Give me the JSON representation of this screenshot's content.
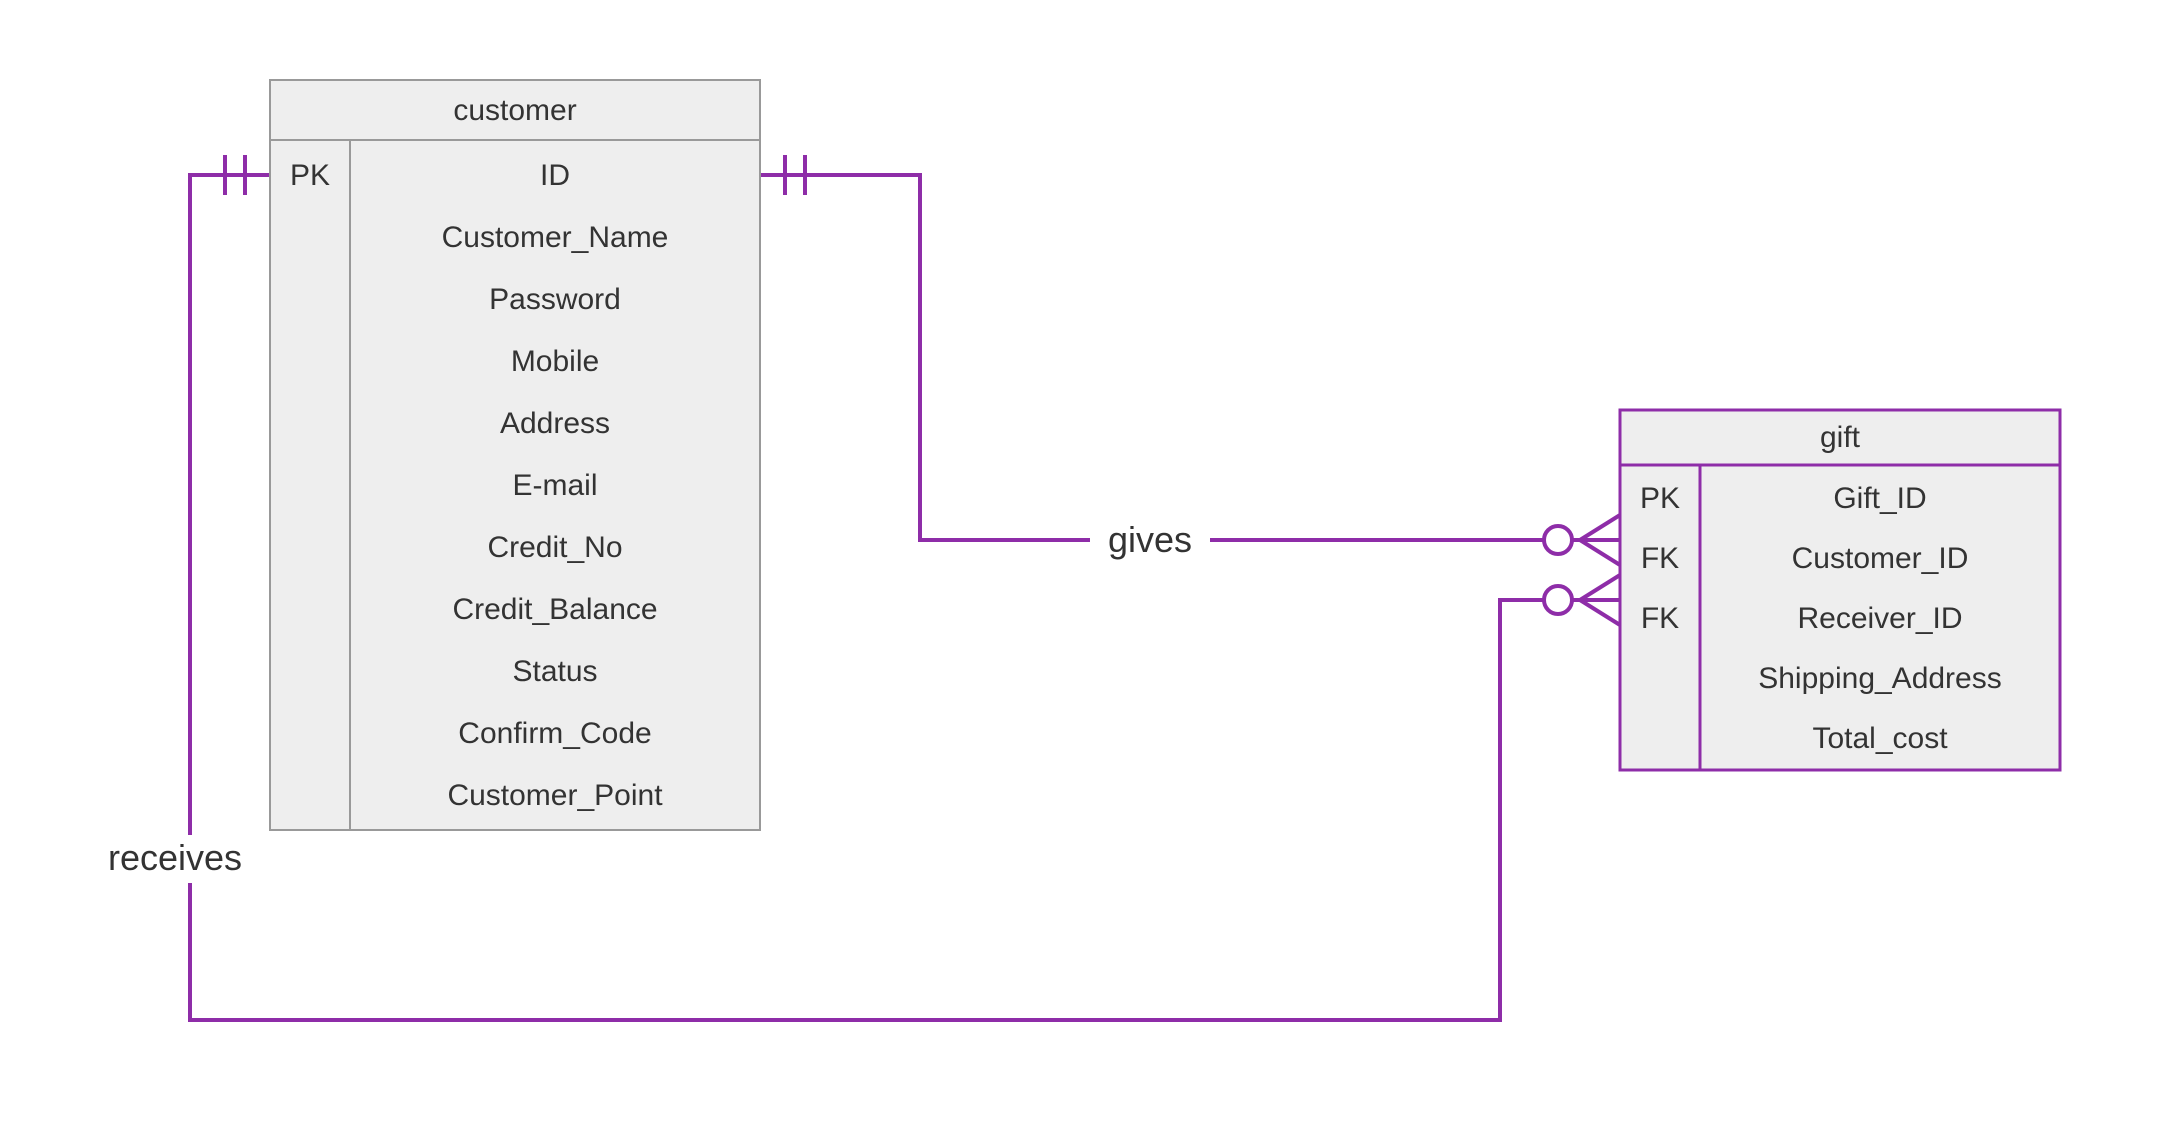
{
  "entities": {
    "customer": {
      "title": "customer",
      "keys": [
        "PK",
        "",
        "",
        "",
        "",
        "",
        "",
        "",
        "",
        "",
        ""
      ],
      "attributes": [
        "ID",
        "Customer_Name",
        "Password",
        "Mobile",
        "Address",
        "E-mail",
        "Credit_No",
        "Credit_Balance",
        "Status",
        "Confirm_Code",
        "Customer_Point"
      ]
    },
    "gift": {
      "title": "gift",
      "keys": [
        "PK",
        "FK",
        "FK",
        "",
        ""
      ],
      "attributes": [
        "Gift_ID",
        "Customer_ID",
        "Receiver_ID",
        "Shipping_Address",
        "Total_cost"
      ]
    }
  },
  "relationships": {
    "gives": {
      "label": "gives",
      "from": "customer",
      "to": "gift",
      "from_cardinality": "exactly-one",
      "to_cardinality": "zero-or-many"
    },
    "receives": {
      "label": "receives",
      "from": "customer",
      "to": "gift",
      "from_cardinality": "exactly-one",
      "to_cardinality": "zero-or-many"
    }
  },
  "chart_data": {
    "type": "diagram",
    "diagram_type": "entity-relationship",
    "entities": [
      {
        "name": "customer",
        "primary_key": [
          "ID"
        ],
        "attributes": [
          "ID",
          "Customer_Name",
          "Password",
          "Mobile",
          "Address",
          "E-mail",
          "Credit_No",
          "Credit_Balance",
          "Status",
          "Confirm_Code",
          "Customer_Point"
        ]
      },
      {
        "name": "gift",
        "primary_key": [
          "Gift_ID"
        ],
        "foreign_keys": [
          "Customer_ID",
          "Receiver_ID"
        ],
        "attributes": [
          "Gift_ID",
          "Customer_ID",
          "Receiver_ID",
          "Shipping_Address",
          "Total_cost"
        ]
      }
    ],
    "relationships": [
      {
        "name": "gives",
        "from": "customer",
        "to": "gift",
        "from_cardinality": "1..1",
        "to_cardinality": "0..*"
      },
      {
        "name": "receives",
        "from": "customer",
        "to": "gift",
        "from_cardinality": "1..1",
        "to_cardinality": "0..*"
      }
    ]
  }
}
